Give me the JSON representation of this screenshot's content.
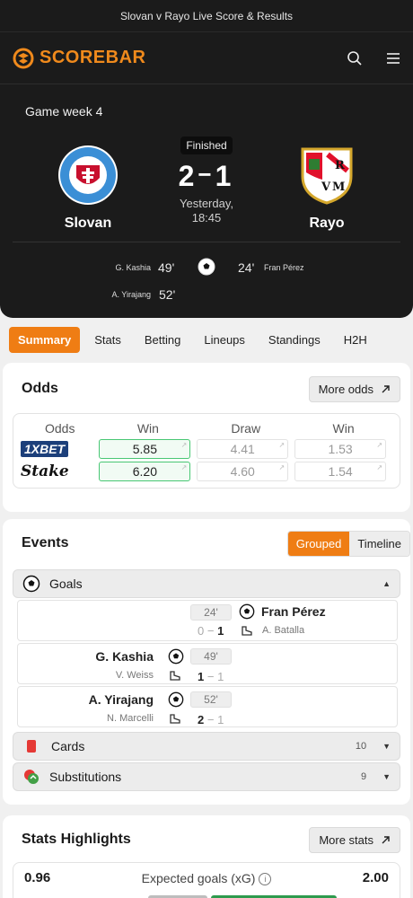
{
  "topbar": {
    "title": "Slovan v Rayo Live Score & Results"
  },
  "header": {
    "brand": "SCOREBAR",
    "icons": [
      "search-icon",
      "menu-icon"
    ]
  },
  "match": {
    "gameweek": "Game week 4",
    "status": "Finished",
    "home": {
      "name": "Slovan",
      "crest_text": "SLOVAN BRATISLAVA"
    },
    "away": {
      "name": "Rayo",
      "crest_text": "RVM"
    },
    "home_score": "2",
    "away_score": "1",
    "kickoff_day": "Yesterday,",
    "kickoff_time": "18:45",
    "scorers": {
      "home": [
        {
          "name": "G. Kashia",
          "minute": "49'"
        },
        {
          "name": "A. Yirajang",
          "minute": "52'"
        }
      ],
      "away": [
        {
          "name": "Fran Pérez",
          "minute": "24'"
        }
      ]
    }
  },
  "tabs": [
    "Summary",
    "Stats",
    "Betting",
    "Lineups",
    "Standings",
    "H2H"
  ],
  "odds": {
    "title": "Odds",
    "more_button": "More odds",
    "headers": [
      "Odds",
      "Win",
      "Draw",
      "Win"
    ],
    "bookmakers": [
      {
        "name": "1XBET",
        "values": [
          "5.85",
          "4.41",
          "1.53"
        ]
      },
      {
        "name": "Stake",
        "values": [
          "6.20",
          "4.60",
          "1.54"
        ]
      }
    ]
  },
  "events": {
    "title": "Events",
    "toggle": {
      "active": "Grouped",
      "inactive": "Timeline"
    },
    "goals_label": "Goals",
    "goals": [
      {
        "side": "away",
        "minute": "24'",
        "player": "Fran Pérez",
        "assist": "A. Batalla",
        "score_home": "0",
        "score_away": "1"
      },
      {
        "side": "home",
        "minute": "49'",
        "player": "G. Kashia",
        "assist": "V. Weiss",
        "score_home": "1",
        "score_away": "1"
      },
      {
        "side": "home",
        "minute": "52'",
        "player": "A. Yirajang",
        "assist": "N. Marcelli",
        "score_home": "2",
        "score_away": "1"
      }
    ],
    "cards": {
      "label": "Cards",
      "count": "10"
    },
    "subs": {
      "label": "Substitutions",
      "count": "9"
    }
  },
  "stats": {
    "title": "Stats Highlights",
    "more_button": "More stats",
    "xg": {
      "label": "Expected goals (xG)",
      "home": "0.96",
      "away": "2.00"
    }
  },
  "colors": {
    "accent": "#ef7d14",
    "dark": "#1b1b1b",
    "best_odds": "#48c774"
  }
}
